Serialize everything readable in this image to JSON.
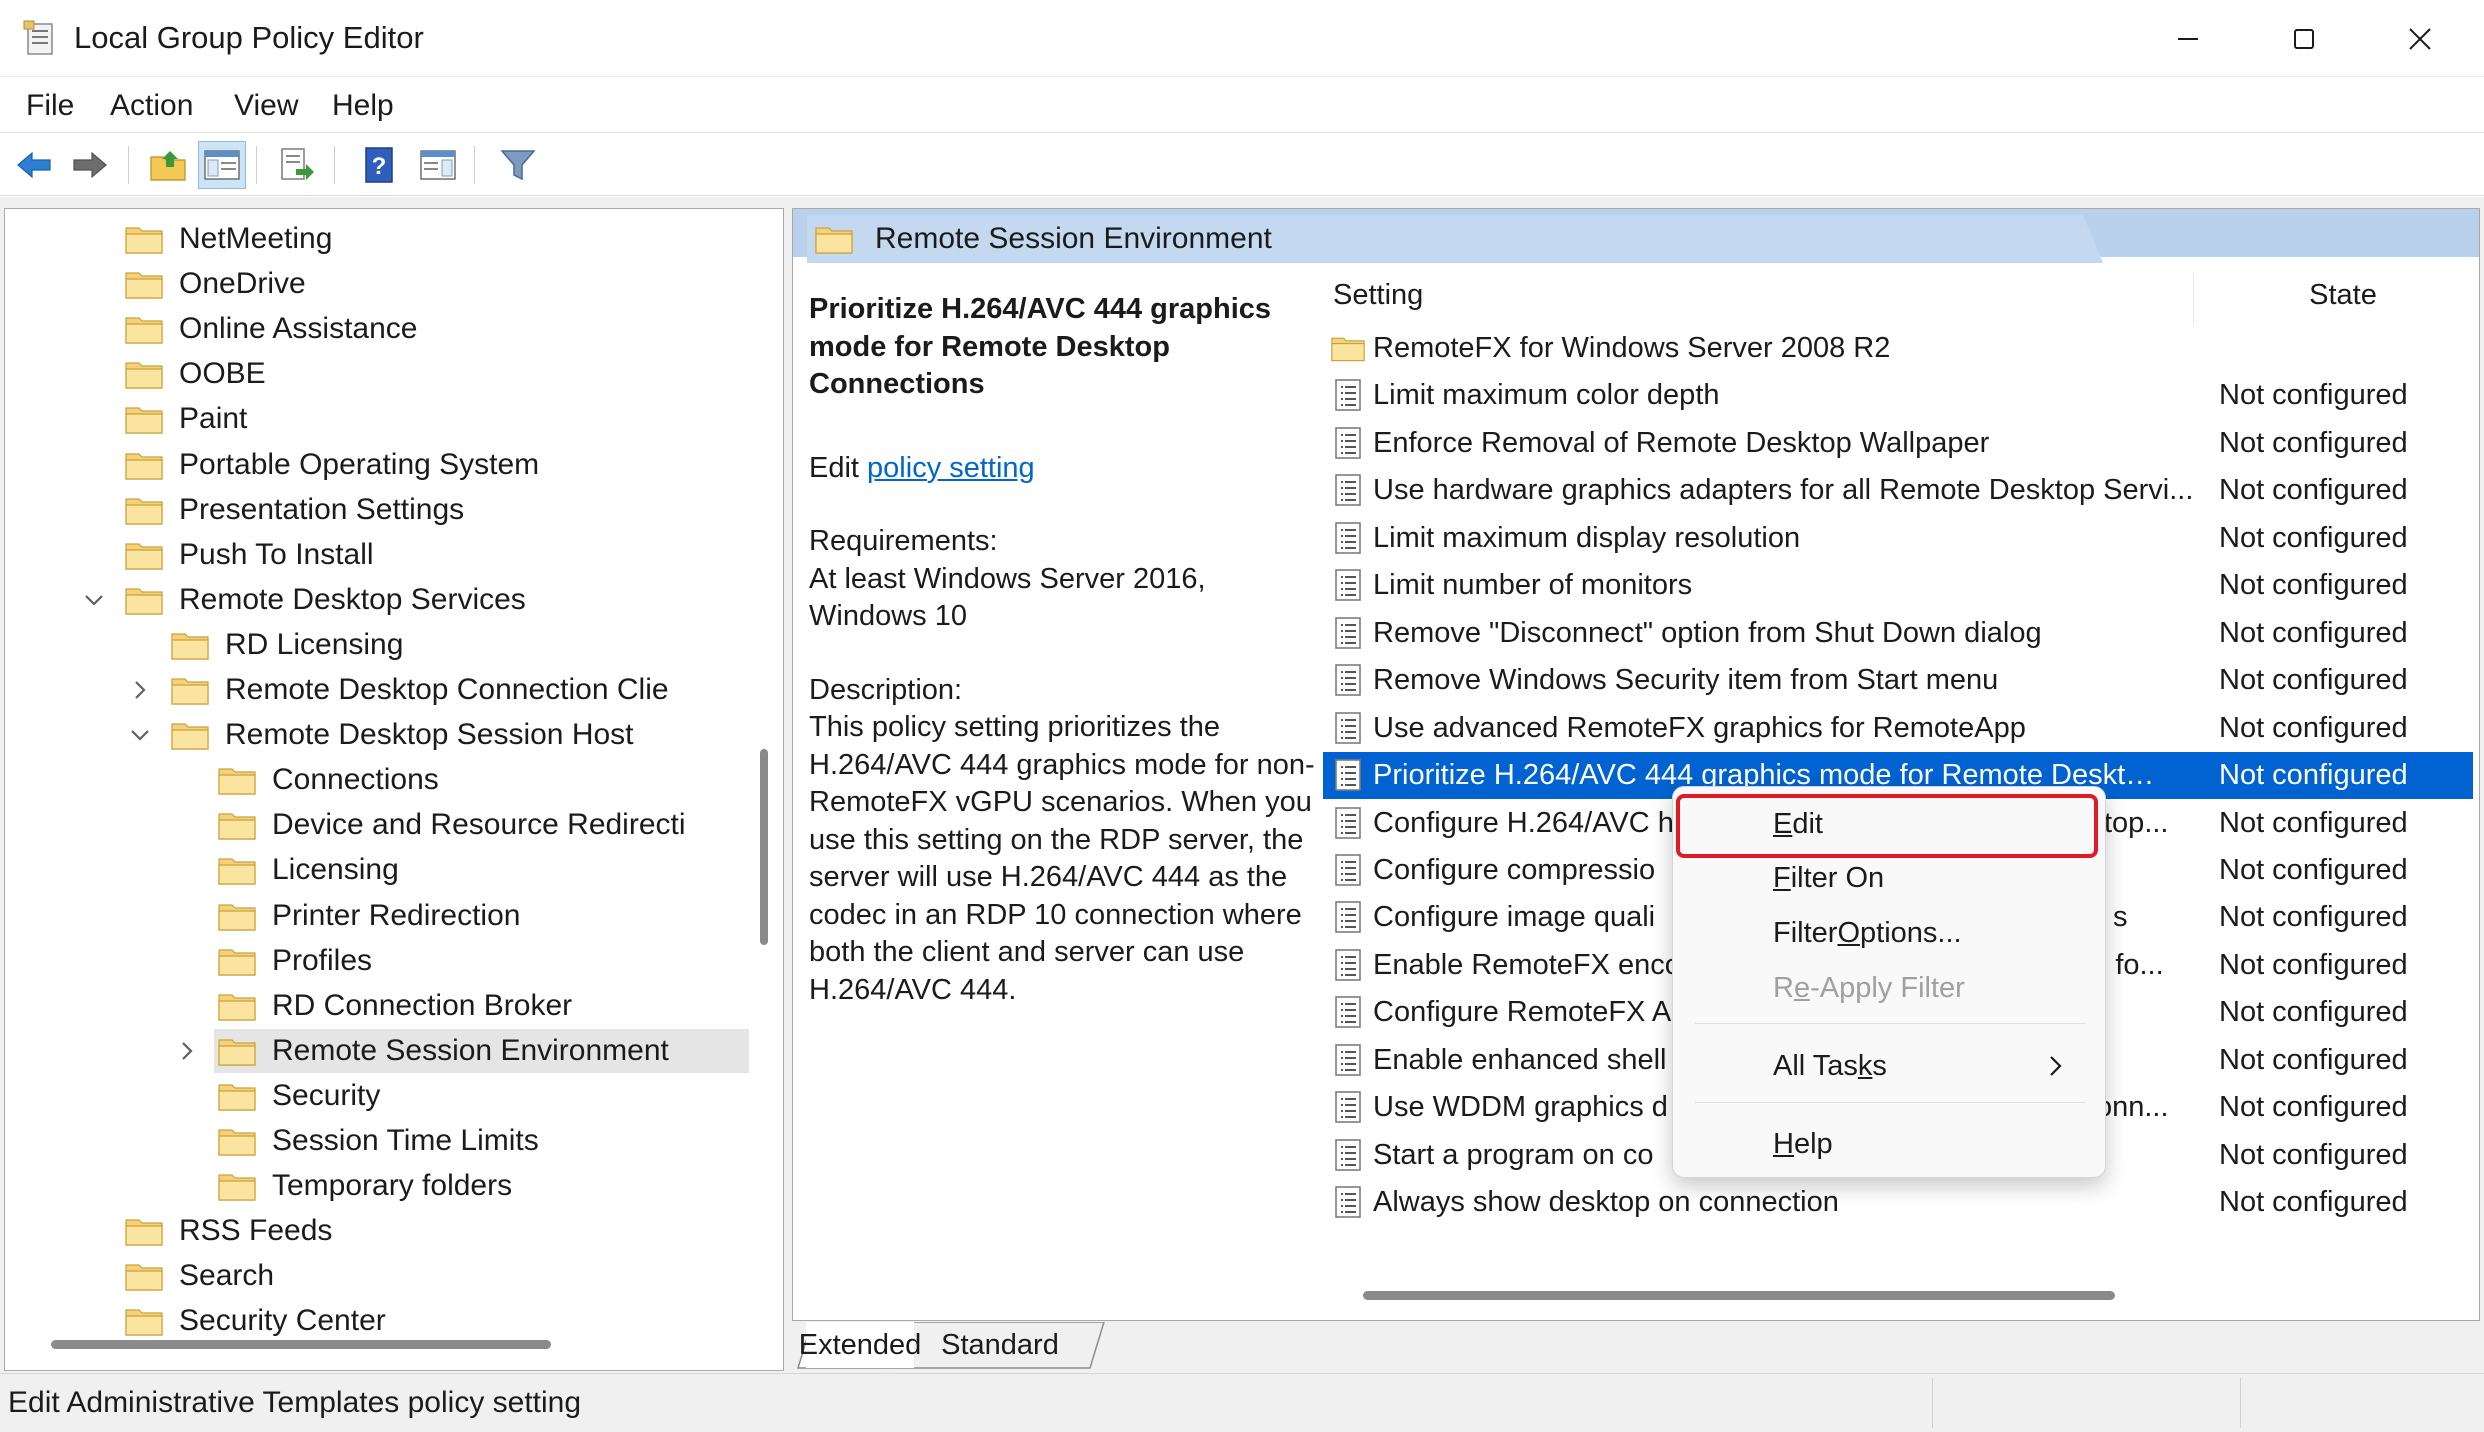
{
  "window": {
    "title": "Local Group Policy Editor",
    "icon": "policy-editor-icon",
    "controls": [
      "minimize-icon",
      "maximize-icon",
      "close-icon"
    ]
  },
  "menu": {
    "file": "File",
    "action": "Action",
    "view": "View",
    "help": "Help"
  },
  "toolbar": {
    "icons": [
      "back-arrow-icon",
      "forward-arrow-icon",
      "up-folder-icon",
      "show-hide-tree-icon",
      "export-list-icon",
      "help-icon",
      "show-hide-action-pane-icon",
      "filter-icon"
    ]
  },
  "tree": {
    "items": [
      {
        "label": "NetMeeting"
      },
      {
        "label": "OneDrive"
      },
      {
        "label": "Online Assistance"
      },
      {
        "label": "OOBE"
      },
      {
        "label": "Paint"
      },
      {
        "label": "Portable Operating System"
      },
      {
        "label": "Presentation Settings"
      },
      {
        "label": "Push To Install"
      },
      {
        "label": "Remote Desktop Services"
      },
      {
        "label": "RD Licensing"
      },
      {
        "label": "Remote Desktop Connection Clie"
      },
      {
        "label": "Remote Desktop Session Host"
      },
      {
        "label": "Connections"
      },
      {
        "label": "Device and Resource Redirecti"
      },
      {
        "label": "Licensing"
      },
      {
        "label": "Printer Redirection"
      },
      {
        "label": "Profiles"
      },
      {
        "label": "RD Connection Broker"
      },
      {
        "label": "Remote Session Environment"
      },
      {
        "label": "Security"
      },
      {
        "label": "Session Time Limits"
      },
      {
        "label": "Temporary folders"
      },
      {
        "label": "RSS Feeds"
      },
      {
        "label": "Search"
      },
      {
        "label": "Security Center"
      }
    ]
  },
  "right_pane": {
    "header": "Remote Session Environment",
    "description": {
      "title": "Prioritize H.264/AVC 444 graphics mode for Remote Desktop Connections",
      "edit_prefix": "Edit",
      "edit_link": "policy setting",
      "requirements_label": "Requirements:",
      "requirements_text": "At least Windows Server 2016, Windows 10",
      "description_label": "Description:",
      "description_text": "This policy setting prioritizes the H.264/AVC 444 graphics mode for non-RemoteFX vGPU scenarios. When you use this setting on the RDP server, the server will use H.264/AVC 444 as the codec in an RDP 10 connection where both the client and server can use H.264/AVC 444."
    },
    "columns": {
      "setting": "Setting",
      "state": "State"
    },
    "rows": [
      {
        "setting": "RemoteFX for Windows Server 2008 R2",
        "state": "",
        "type": "folder"
      },
      {
        "setting": "Limit maximum color depth",
        "state": "Not configured",
        "type": "policy"
      },
      {
        "setting": "Enforce Removal of Remote Desktop Wallpaper",
        "state": "Not configured",
        "type": "policy"
      },
      {
        "setting": "Use hardware graphics adapters for all Remote Desktop Servi...",
        "state": "Not configured",
        "type": "policy"
      },
      {
        "setting": "Limit maximum display resolution",
        "state": "Not configured",
        "type": "policy"
      },
      {
        "setting": "Limit number of monitors",
        "state": "Not configured",
        "type": "policy"
      },
      {
        "setting": "Remove \"Disconnect\" option from Shut Down dialog",
        "state": "Not configured",
        "type": "policy"
      },
      {
        "setting": "Remove Windows Security item from Start menu",
        "state": "Not configured",
        "type": "policy"
      },
      {
        "setting": "Use advanced RemoteFX graphics for RemoteApp",
        "state": "Not configured",
        "type": "policy"
      },
      {
        "setting": "Prioritize H.264/AVC 444 graphics mode for Remote Desktop C...",
        "state": "Not configured",
        "type": "policy",
        "selected": true
      },
      {
        "setting": "Configure H.264/AVC h",
        "setting_tail": "sktop...",
        "state": "Not configured",
        "type": "policy"
      },
      {
        "setting": "Configure compressio",
        "setting_tail": "",
        "state": "Not configured",
        "type": "policy"
      },
      {
        "setting": "Configure image quali",
        "setting_tail": "s",
        "state": "Not configured",
        "type": "policy"
      },
      {
        "setting": "Enable RemoteFX enco",
        "setting_tail": "ed fo...",
        "state": "Not configured",
        "type": "policy"
      },
      {
        "setting": "Configure RemoteFX A",
        "setting_tail": "",
        "state": "Not configured",
        "type": "policy"
      },
      {
        "setting": "Enable enhanced shell",
        "setting_tail": "",
        "state": "Not configured",
        "type": "policy"
      },
      {
        "setting": "Use WDDM graphics d",
        "setting_tail": "Conn...",
        "state": "Not configured",
        "type": "policy"
      },
      {
        "setting": "Start a program on co",
        "setting_tail": "",
        "state": "Not configured",
        "type": "policy"
      },
      {
        "setting": "Always show desktop on connection",
        "state": "Not configured",
        "type": "policy"
      }
    ]
  },
  "tabs": {
    "extended": "Extended",
    "standard": "Standard"
  },
  "status": {
    "text": "Edit Administrative Templates policy setting"
  },
  "context_menu": {
    "edit": {
      "pre": "",
      "key": "E",
      "post": "dit"
    },
    "filter_on": {
      "pre": "",
      "key": "F",
      "post": "ilter On"
    },
    "filter_options": {
      "pre": "Filter ",
      "key": "O",
      "post": "ptions..."
    },
    "reapply_filter": {
      "pre": "R",
      "key": "e",
      "post": "-Apply Filter"
    },
    "all_tasks": {
      "pre": "All Tas",
      "key": "k",
      "post": "s"
    },
    "help": {
      "pre": "",
      "key": "H",
      "post": "elp"
    }
  },
  "colors": {
    "selection": "#0063d1",
    "header_band": "#b9d1ea",
    "link": "#0066cc",
    "highlight_box": "#e01b24"
  }
}
